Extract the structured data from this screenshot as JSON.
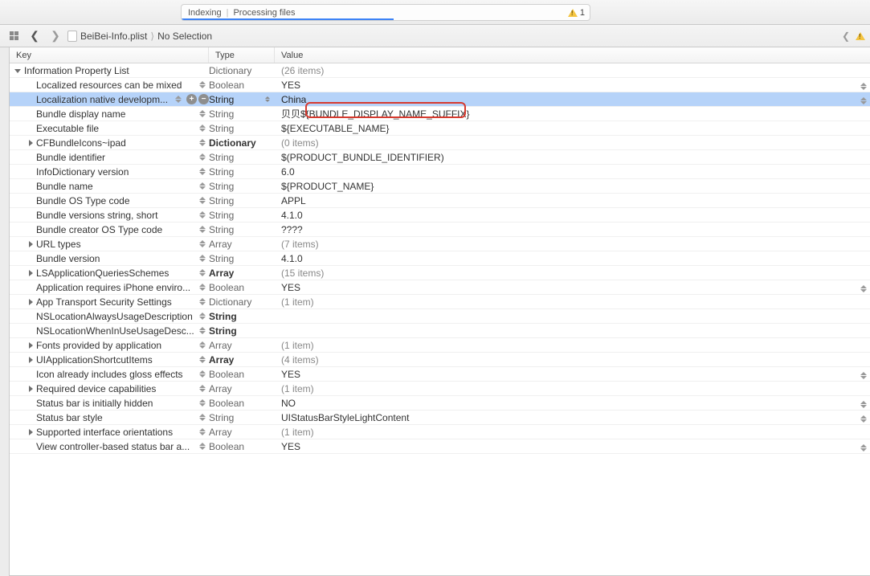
{
  "toolbar": {
    "activity_a": "Indexing",
    "activity_b": "Processing files",
    "warn_count": "1"
  },
  "breadcrumb": {
    "file": "BeiBei-Info.plist",
    "selection": "No Selection"
  },
  "columns": {
    "key": "Key",
    "type": "Type",
    "value": "Value"
  },
  "rows": [
    {
      "indent": 0,
      "disc": "open",
      "key": "Information Property List",
      "type": "Dictionary",
      "typeBold": false,
      "value": "(26 items)",
      "dim": true,
      "editable": false,
      "selected": false,
      "rightStepper": false
    },
    {
      "indent": 1,
      "disc": "none",
      "key": "Localized resources can be mixed",
      "type": "Boolean",
      "typeBold": false,
      "value": "YES",
      "dim": false,
      "editable": true,
      "selected": false,
      "rightStepper": true
    },
    {
      "indent": 1,
      "disc": "none",
      "key": "Localization native developm...",
      "type": "String",
      "typeBold": false,
      "value": "China",
      "dim": false,
      "editable": true,
      "selected": true,
      "addRemove": true,
      "typeArrows": true,
      "rightStepper": true
    },
    {
      "indent": 1,
      "disc": "none",
      "key": "Bundle display name",
      "type": "String",
      "typeBold": false,
      "value": "贝贝${BUNDLE_DISPLAY_NAME_SUFFIX}",
      "dim": false,
      "editable": true,
      "selected": false,
      "rightStepper": false
    },
    {
      "indent": 1,
      "disc": "none",
      "key": "Executable file",
      "type": "String",
      "typeBold": false,
      "value": "${EXECUTABLE_NAME}",
      "dim": false,
      "editable": true,
      "selected": false,
      "rightStepper": false
    },
    {
      "indent": 1,
      "disc": "closed",
      "key": "CFBundleIcons~ipad",
      "type": "Dictionary",
      "typeBold": true,
      "value": "(0 items)",
      "dim": true,
      "editable": true,
      "selected": false,
      "rightStepper": false
    },
    {
      "indent": 1,
      "disc": "none",
      "key": "Bundle identifier",
      "type": "String",
      "typeBold": false,
      "value": "$(PRODUCT_BUNDLE_IDENTIFIER)",
      "dim": false,
      "editable": true,
      "selected": false,
      "rightStepper": false
    },
    {
      "indent": 1,
      "disc": "none",
      "key": "InfoDictionary version",
      "type": "String",
      "typeBold": false,
      "value": "6.0",
      "dim": false,
      "editable": true,
      "selected": false,
      "rightStepper": false
    },
    {
      "indent": 1,
      "disc": "none",
      "key": "Bundle name",
      "type": "String",
      "typeBold": false,
      "value": "${PRODUCT_NAME}",
      "dim": false,
      "editable": true,
      "selected": false,
      "rightStepper": false
    },
    {
      "indent": 1,
      "disc": "none",
      "key": "Bundle OS Type code",
      "type": "String",
      "typeBold": false,
      "value": "APPL",
      "dim": false,
      "editable": true,
      "selected": false,
      "rightStepper": false
    },
    {
      "indent": 1,
      "disc": "none",
      "key": "Bundle versions string, short",
      "type": "String",
      "typeBold": false,
      "value": "4.1.0",
      "dim": false,
      "editable": true,
      "selected": false,
      "rightStepper": false
    },
    {
      "indent": 1,
      "disc": "none",
      "key": "Bundle creator OS Type code",
      "type": "String",
      "typeBold": false,
      "value": "????",
      "dim": false,
      "editable": true,
      "selected": false,
      "rightStepper": false
    },
    {
      "indent": 1,
      "disc": "closed",
      "key": "URL types",
      "type": "Array",
      "typeBold": false,
      "value": "(7 items)",
      "dim": true,
      "editable": true,
      "selected": false,
      "rightStepper": false
    },
    {
      "indent": 1,
      "disc": "none",
      "key": "Bundle version",
      "type": "String",
      "typeBold": false,
      "value": "4.1.0",
      "dim": false,
      "editable": true,
      "selected": false,
      "rightStepper": false
    },
    {
      "indent": 1,
      "disc": "closed",
      "key": "LSApplicationQueriesSchemes",
      "type": "Array",
      "typeBold": true,
      "value": "(15 items)",
      "dim": true,
      "editable": true,
      "selected": false,
      "rightStepper": false
    },
    {
      "indent": 1,
      "disc": "none",
      "key": "Application requires iPhone enviro...",
      "type": "Boolean",
      "typeBold": false,
      "value": "YES",
      "dim": false,
      "editable": true,
      "selected": false,
      "rightStepper": true
    },
    {
      "indent": 1,
      "disc": "closed",
      "key": "App Transport Security Settings",
      "type": "Dictionary",
      "typeBold": false,
      "value": "(1 item)",
      "dim": true,
      "editable": true,
      "selected": false,
      "rightStepper": false
    },
    {
      "indent": 1,
      "disc": "none",
      "key": "NSLocationAlwaysUsageDescription",
      "type": "String",
      "typeBold": true,
      "value": "",
      "dim": false,
      "editable": true,
      "selected": false,
      "rightStepper": false
    },
    {
      "indent": 1,
      "disc": "none",
      "key": "NSLocationWhenInUseUsageDesc...",
      "type": "String",
      "typeBold": true,
      "value": "",
      "dim": false,
      "editable": true,
      "selected": false,
      "rightStepper": false
    },
    {
      "indent": 1,
      "disc": "closed",
      "key": "Fonts provided by application",
      "type": "Array",
      "typeBold": false,
      "value": "(1 item)",
      "dim": true,
      "editable": true,
      "selected": false,
      "rightStepper": false
    },
    {
      "indent": 1,
      "disc": "closed",
      "key": "UIApplicationShortcutItems",
      "type": "Array",
      "typeBold": true,
      "value": "(4 items)",
      "dim": true,
      "editable": true,
      "selected": false,
      "rightStepper": false
    },
    {
      "indent": 1,
      "disc": "none",
      "key": "Icon already includes gloss effects",
      "type": "Boolean",
      "typeBold": false,
      "value": "YES",
      "dim": false,
      "editable": true,
      "selected": false,
      "rightStepper": true
    },
    {
      "indent": 1,
      "disc": "closed",
      "key": "Required device capabilities",
      "type": "Array",
      "typeBold": false,
      "value": "(1 item)",
      "dim": true,
      "editable": true,
      "selected": false,
      "rightStepper": false
    },
    {
      "indent": 1,
      "disc": "none",
      "key": "Status bar is initially hidden",
      "type": "Boolean",
      "typeBold": false,
      "value": "NO",
      "dim": false,
      "editable": true,
      "selected": false,
      "rightStepper": true
    },
    {
      "indent": 1,
      "disc": "none",
      "key": "Status bar style",
      "type": "String",
      "typeBold": false,
      "value": "UIStatusBarStyleLightContent",
      "dim": false,
      "editable": true,
      "selected": false,
      "rightStepper": true
    },
    {
      "indent": 1,
      "disc": "closed",
      "key": "Supported interface orientations",
      "type": "Array",
      "typeBold": false,
      "value": "(1 item)",
      "dim": true,
      "editable": true,
      "selected": false,
      "rightStepper": false
    },
    {
      "indent": 1,
      "disc": "none",
      "key": "View controller-based status bar a...",
      "type": "Boolean",
      "typeBold": false,
      "value": "YES",
      "dim": false,
      "editable": true,
      "selected": false,
      "rightStepper": true
    }
  ]
}
